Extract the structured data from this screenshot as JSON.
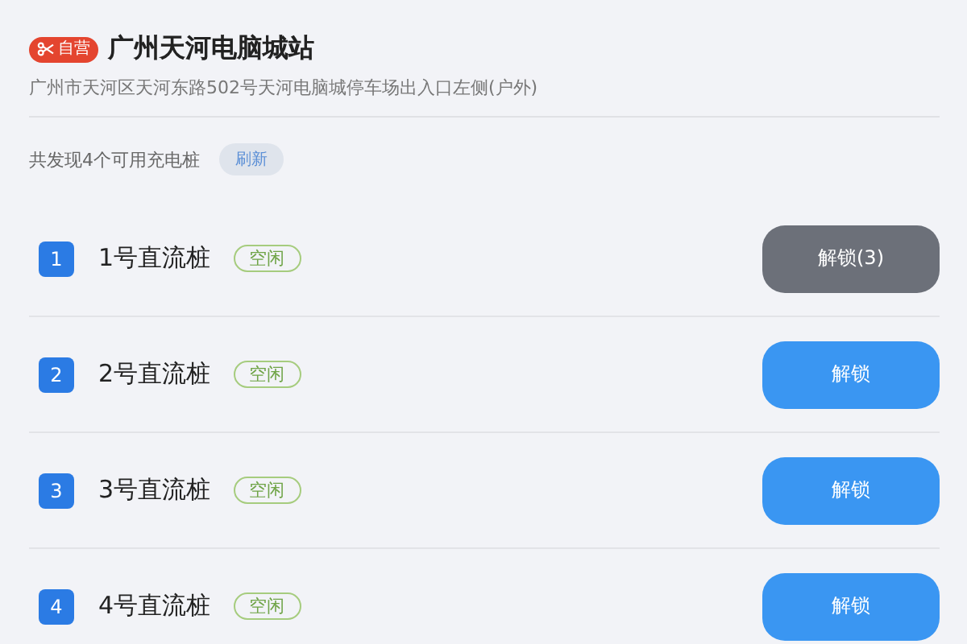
{
  "station": {
    "badge": "自营",
    "name": "广州天河电脑城站",
    "address": "广州市天河区天河东路502号天河电脑城停车场出入口左侧(户外)"
  },
  "summary": {
    "text": "共发现4个可用充电桩",
    "refresh": "刷新"
  },
  "piles": [
    {
      "number": "1",
      "name": "1号直流桩",
      "status": "空闲",
      "button": "解锁(3)",
      "disabled": true
    },
    {
      "number": "2",
      "name": "2号直流桩",
      "status": "空闲",
      "button": "解锁",
      "disabled": false
    },
    {
      "number": "3",
      "name": "3号直流桩",
      "status": "空闲",
      "button": "解锁",
      "disabled": false
    },
    {
      "number": "4",
      "name": "4号直流桩",
      "status": "空闲",
      "button": "解锁",
      "disabled": false
    }
  ]
}
